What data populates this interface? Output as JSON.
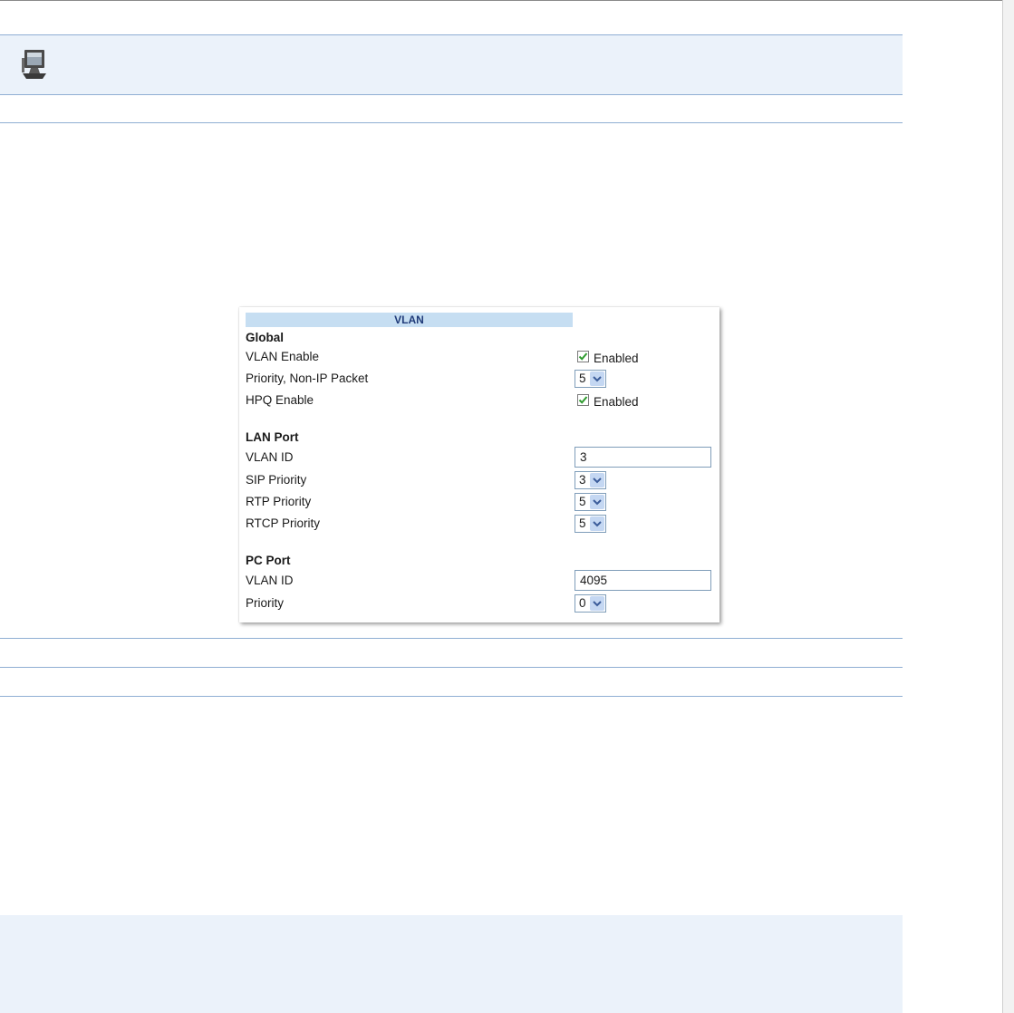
{
  "header": {
    "icon": "computer-icon"
  },
  "vlan": {
    "title": "VLAN",
    "global": {
      "heading": "Global",
      "vlan_enable": {
        "label": "VLAN Enable",
        "checked": true,
        "state_label": "Enabled"
      },
      "priority_non_ip": {
        "label": "Priority, Non-IP Packet",
        "value": "5"
      },
      "hpq_enable": {
        "label": "HPQ Enable",
        "checked": true,
        "state_label": "Enabled"
      }
    },
    "lan_port": {
      "heading": "LAN Port",
      "vlan_id": {
        "label": "VLAN ID",
        "value": "3"
      },
      "sip_priority": {
        "label": "SIP Priority",
        "value": "3"
      },
      "rtp_priority": {
        "label": "RTP Priority",
        "value": "5"
      },
      "rtcp_priority": {
        "label": "RTCP Priority",
        "value": "5"
      }
    },
    "pc_port": {
      "heading": "PC Port",
      "vlan_id": {
        "label": "VLAN ID",
        "value": "4095"
      },
      "priority": {
        "label": "Priority",
        "value": "0"
      }
    }
  },
  "colors": {
    "header_band": "#ebf2fa",
    "rule": "#8faed3",
    "vlan_header": "#c6def2",
    "check": "#2e9b2e"
  }
}
